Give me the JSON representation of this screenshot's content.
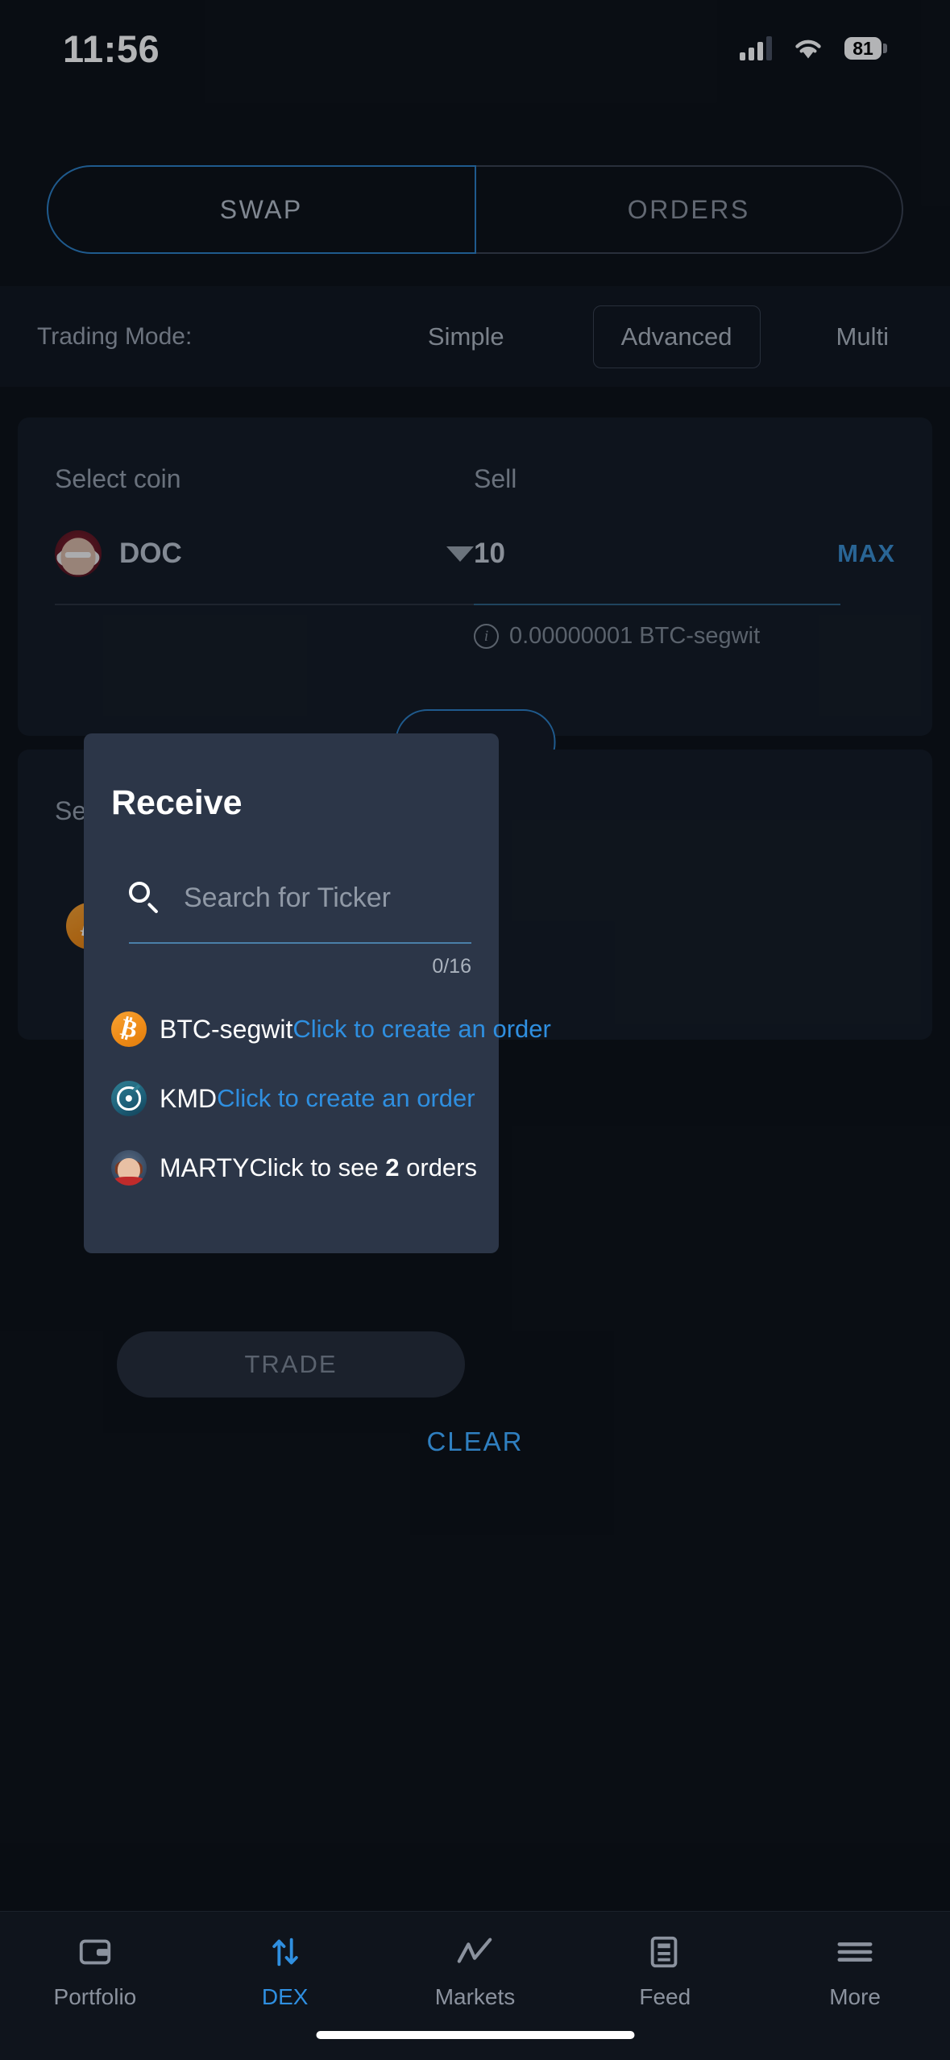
{
  "status_bar": {
    "time": "11:56",
    "battery_percent": "81",
    "signal_icon": "cellular-signal-icon",
    "wifi_icon": "wifi-icon",
    "battery_icon": "battery-icon"
  },
  "top_tabs": {
    "items": [
      {
        "label": "SWAP",
        "active": true
      },
      {
        "label": "ORDERS",
        "active": false
      }
    ]
  },
  "trading_mode": {
    "label": "Trading Mode:",
    "options": [
      {
        "label": "Simple",
        "selected": false
      },
      {
        "label": "Advanced",
        "selected": true
      },
      {
        "label": "Multi",
        "selected": false
      }
    ]
  },
  "sell_card": {
    "select_coin_label": "Select coin",
    "sell_label": "Sell",
    "coin_ticker": "DOC",
    "coin_icon": "doc-coin-icon",
    "dropdown_icon": "chevron-down-icon",
    "amount": "10",
    "max_label": "MAX",
    "fee_icon": "info-icon",
    "fee_text": "0.00000001 BTC-segwit"
  },
  "receive_card": {
    "select_coin_label": "Sel",
    "coin_icon": "btc-coin-icon"
  },
  "modal": {
    "title": "Receive",
    "search": {
      "icon": "search-icon",
      "placeholder": "Search for Ticker",
      "value": "",
      "counter": "0/16"
    },
    "coins": [
      {
        "ticker": "BTC-segwit",
        "icon": "btc-coin-icon",
        "action": "Click to create an order",
        "action_style": "link",
        "order_count": ""
      },
      {
        "ticker": "KMD",
        "icon": "kmd-coin-icon",
        "action": "Click to create an order",
        "action_style": "link",
        "order_count": ""
      },
      {
        "ticker": "MARTY",
        "icon": "marty-coin-icon",
        "action_prefix": "Click to see ",
        "order_count": "2",
        "action_suffix": " orders",
        "action_style": "plain"
      }
    ]
  },
  "actions": {
    "trade_label": "TRADE",
    "clear_label": "CLEAR"
  },
  "bottom_nav": {
    "items": [
      {
        "label": "Portfolio",
        "icon": "portfolio-icon",
        "active": false
      },
      {
        "label": "DEX",
        "icon": "swap-arrows-icon",
        "active": true
      },
      {
        "label": "Markets",
        "icon": "chart-line-icon",
        "active": false
      },
      {
        "label": "Feed",
        "icon": "news-feed-icon",
        "active": false
      },
      {
        "label": "More",
        "icon": "hamburger-menu-icon",
        "active": false
      }
    ]
  },
  "colors": {
    "accent": "#2f8fe0",
    "background": "#0c1016",
    "card": "#141a24",
    "modal": "#2c3648"
  }
}
